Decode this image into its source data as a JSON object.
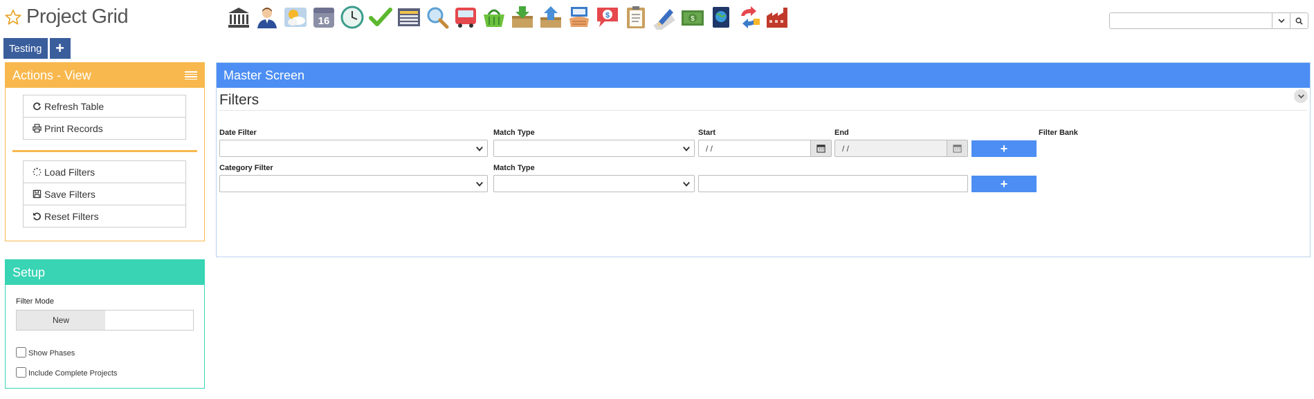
{
  "app": {
    "title": "Project Grid",
    "accent": "#f8b84e"
  },
  "toolbar": {
    "icons": [
      "bank-icon",
      "user-icon",
      "weather-icon",
      "calendar-16-icon",
      "clock-icon",
      "checkmark-icon",
      "spreadsheet-icon",
      "magnifier-icon",
      "bus-icon",
      "basket-icon",
      "download-box-icon",
      "upload-box-icon",
      "hand-card-icon",
      "chat-dollar-icon",
      "clipboard-icon",
      "pencil-ruler-icon",
      "money-icon",
      "globe-book-icon",
      "sync-arrows-icon",
      "factory-icon"
    ],
    "calendar_number": "16"
  },
  "search": {
    "value": "",
    "placeholder": ""
  },
  "tabs": {
    "items": [
      "Testing"
    ],
    "add_label": "+"
  },
  "actions_panel": {
    "title": "Actions - View",
    "color": "#f8b84e",
    "buttons": [
      "Refresh Table",
      "Print Records"
    ],
    "filter_buttons": [
      "Load Filters",
      "Save Filters",
      "Reset Filters"
    ]
  },
  "setup_panel": {
    "title": "Setup",
    "color": "#38d4b4",
    "filter_mode_label": "Filter Mode",
    "filter_mode_selected": "New",
    "show_phases_label": "Show Phases",
    "show_phases_checked": false,
    "include_complete_label": "Include Complete Projects",
    "include_complete_checked": false
  },
  "master": {
    "title": "Master Screen",
    "color": "#4c8ef3",
    "filters_title": "Filters",
    "date_filter_label": "Date Filter",
    "match_type_label": "Match Type",
    "start_label": "Start",
    "end_label": "End",
    "filter_bank_label": "Filter Bank",
    "start_value": " /  /",
    "end_value": " /  /",
    "category_filter_label": "Category Filter",
    "category_match_type_label": "Match Type",
    "add_label": "+"
  }
}
